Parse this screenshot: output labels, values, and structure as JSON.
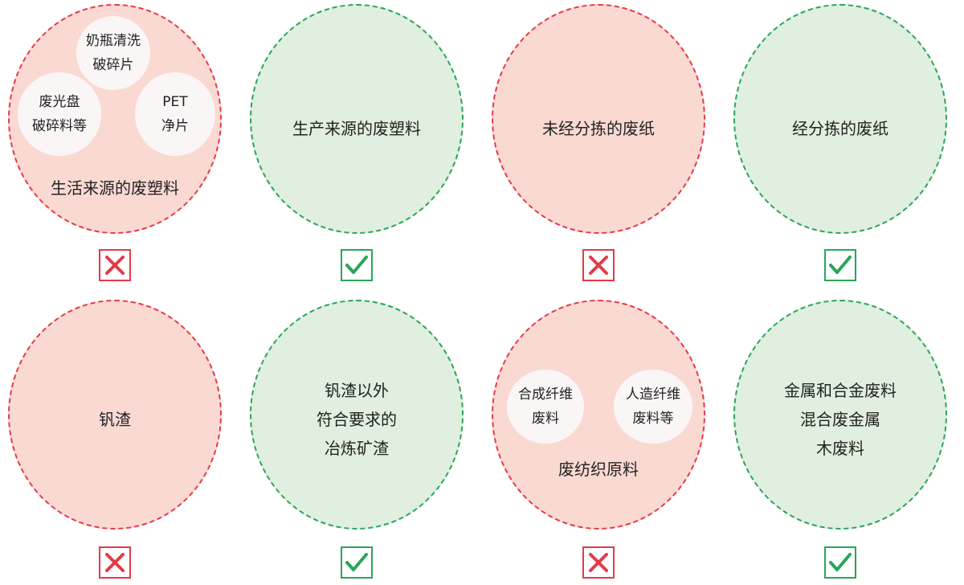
{
  "colors": {
    "red_border": "#e33a48",
    "red_fill": "#fbd9d3",
    "green_border": "#28a55a",
    "green_fill": "#e0efdf",
    "bubble_fill": "#faf6f6"
  },
  "cards": [
    {
      "status": "bad",
      "mark": "cross-icon",
      "label": "生活来源的废塑料",
      "bubbles": [
        "奶瓶清洗\n破碎片",
        "废光盘\n破碎料等",
        "PET\n净片"
      ]
    },
    {
      "status": "good",
      "mark": "check-icon",
      "label": "生产来源的废塑料"
    },
    {
      "status": "bad",
      "mark": "cross-icon",
      "label": "未经分拣的废纸"
    },
    {
      "status": "good",
      "mark": "check-icon",
      "label": "经分拣的废纸"
    },
    {
      "status": "bad",
      "mark": "cross-icon",
      "label": "钒渣"
    },
    {
      "status": "good",
      "mark": "check-icon",
      "label": "钒渣以外\n符合要求的\n冶炼矿渣"
    },
    {
      "status": "bad",
      "mark": "cross-icon",
      "label": "废纺织原料",
      "bubbles": [
        "合成纤维\n废料",
        "人造纤维\n废料等"
      ]
    },
    {
      "status": "good",
      "mark": "check-icon",
      "label": "金属和合金废料\n混合废金属\n木废料"
    }
  ]
}
